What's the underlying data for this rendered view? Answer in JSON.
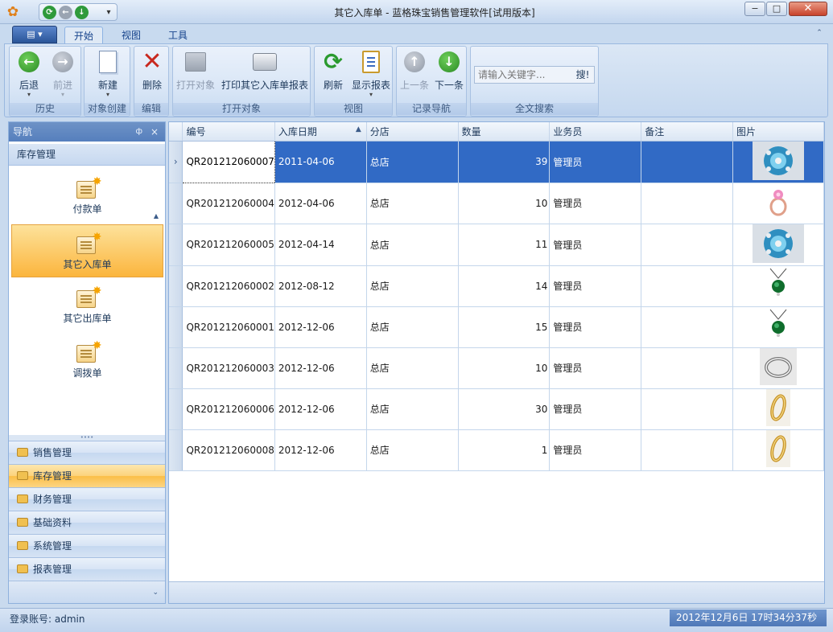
{
  "window": {
    "title": "其它入库单 - 蓝格珠宝销售管理软件[试用版本]",
    "controls": {
      "minimize": "−",
      "maximize": "□",
      "close": "✕"
    }
  },
  "ribbon": {
    "tabs": [
      "开始",
      "视图",
      "工具"
    ],
    "active_tab": "开始",
    "groups": {
      "history": {
        "label": "历史",
        "back": "后退",
        "forward": "前进"
      },
      "create": {
        "label": "对象创建",
        "new": "新建"
      },
      "edit": {
        "label": "编辑",
        "delete": "删除"
      },
      "open": {
        "label": "打开对象",
        "open": "打开对象",
        "print": "打印其它入库单报表"
      },
      "view": {
        "label": "视图",
        "refresh": "刷新",
        "report": "显示报表"
      },
      "nav": {
        "label": "记录导航",
        "prev": "上一条",
        "next": "下一条"
      },
      "search": {
        "label": "全文搜索",
        "placeholder": "请输入关键字...",
        "button": "搜!"
      }
    }
  },
  "nav": {
    "header": "导航",
    "pin": "ㅁ",
    "close": "×",
    "category": "库存管理",
    "items": [
      {
        "label": "付款单",
        "icon": "document-star-icon",
        "selected": false
      },
      {
        "label": "其它入库单",
        "icon": "document-star-icon",
        "selected": true
      },
      {
        "label": "其它出库单",
        "icon": "document-star-icon",
        "selected": false
      },
      {
        "label": "调拨单",
        "icon": "document-star-icon",
        "selected": false
      }
    ],
    "modules": [
      {
        "label": "销售管理",
        "selected": false
      },
      {
        "label": "库存管理",
        "selected": true
      },
      {
        "label": "财务管理",
        "selected": false
      },
      {
        "label": "基础资料",
        "selected": false
      },
      {
        "label": "系统管理",
        "selected": false
      },
      {
        "label": "报表管理",
        "selected": false
      }
    ]
  },
  "grid": {
    "columns": [
      "编号",
      "入库日期",
      "分店",
      "数量",
      "业务员",
      "备注",
      "图片"
    ],
    "sorted_column": "入库日期",
    "rows": [
      {
        "id": "QR201212060007",
        "date": "2011-04-06",
        "store": "总店",
        "qty": "39",
        "staff": "管理员",
        "note": "",
        "pic": "brooch-icon",
        "selected": true
      },
      {
        "id": "QR201212060004",
        "date": "2012-04-06",
        "store": "总店",
        "qty": "10",
        "staff": "管理员",
        "note": "",
        "pic": "ring-pink-icon",
        "selected": false
      },
      {
        "id": "QR201212060005",
        "date": "2012-04-14",
        "store": "总店",
        "qty": "11",
        "staff": "管理员",
        "note": "",
        "pic": "brooch-icon",
        "selected": false
      },
      {
        "id": "QR201212060002",
        "date": "2012-08-12",
        "store": "总店",
        "qty": "14",
        "staff": "管理员",
        "note": "",
        "pic": "pendant-icon",
        "selected": false
      },
      {
        "id": "QR201212060001",
        "date": "2012-12-06",
        "store": "总店",
        "qty": "15",
        "staff": "管理员",
        "note": "",
        "pic": "pendant-icon",
        "selected": false
      },
      {
        "id": "QR201212060003",
        "date": "2012-12-06",
        "store": "总店",
        "qty": "10",
        "staff": "管理员",
        "note": "",
        "pic": "ring-silver-icon",
        "selected": false
      },
      {
        "id": "QR201212060006",
        "date": "2012-12-06",
        "store": "总店",
        "qty": "30",
        "staff": "管理员",
        "note": "",
        "pic": "ring-gold-icon",
        "selected": false
      },
      {
        "id": "QR201212060008",
        "date": "2012-12-06",
        "store": "总店",
        "qty": "1",
        "staff": "管理员",
        "note": "",
        "pic": "ring-gold-icon",
        "selected": false
      }
    ]
  },
  "status": {
    "account": "登录账号: admin",
    "datetime": "2012年12月6日 17时34分37秒"
  }
}
